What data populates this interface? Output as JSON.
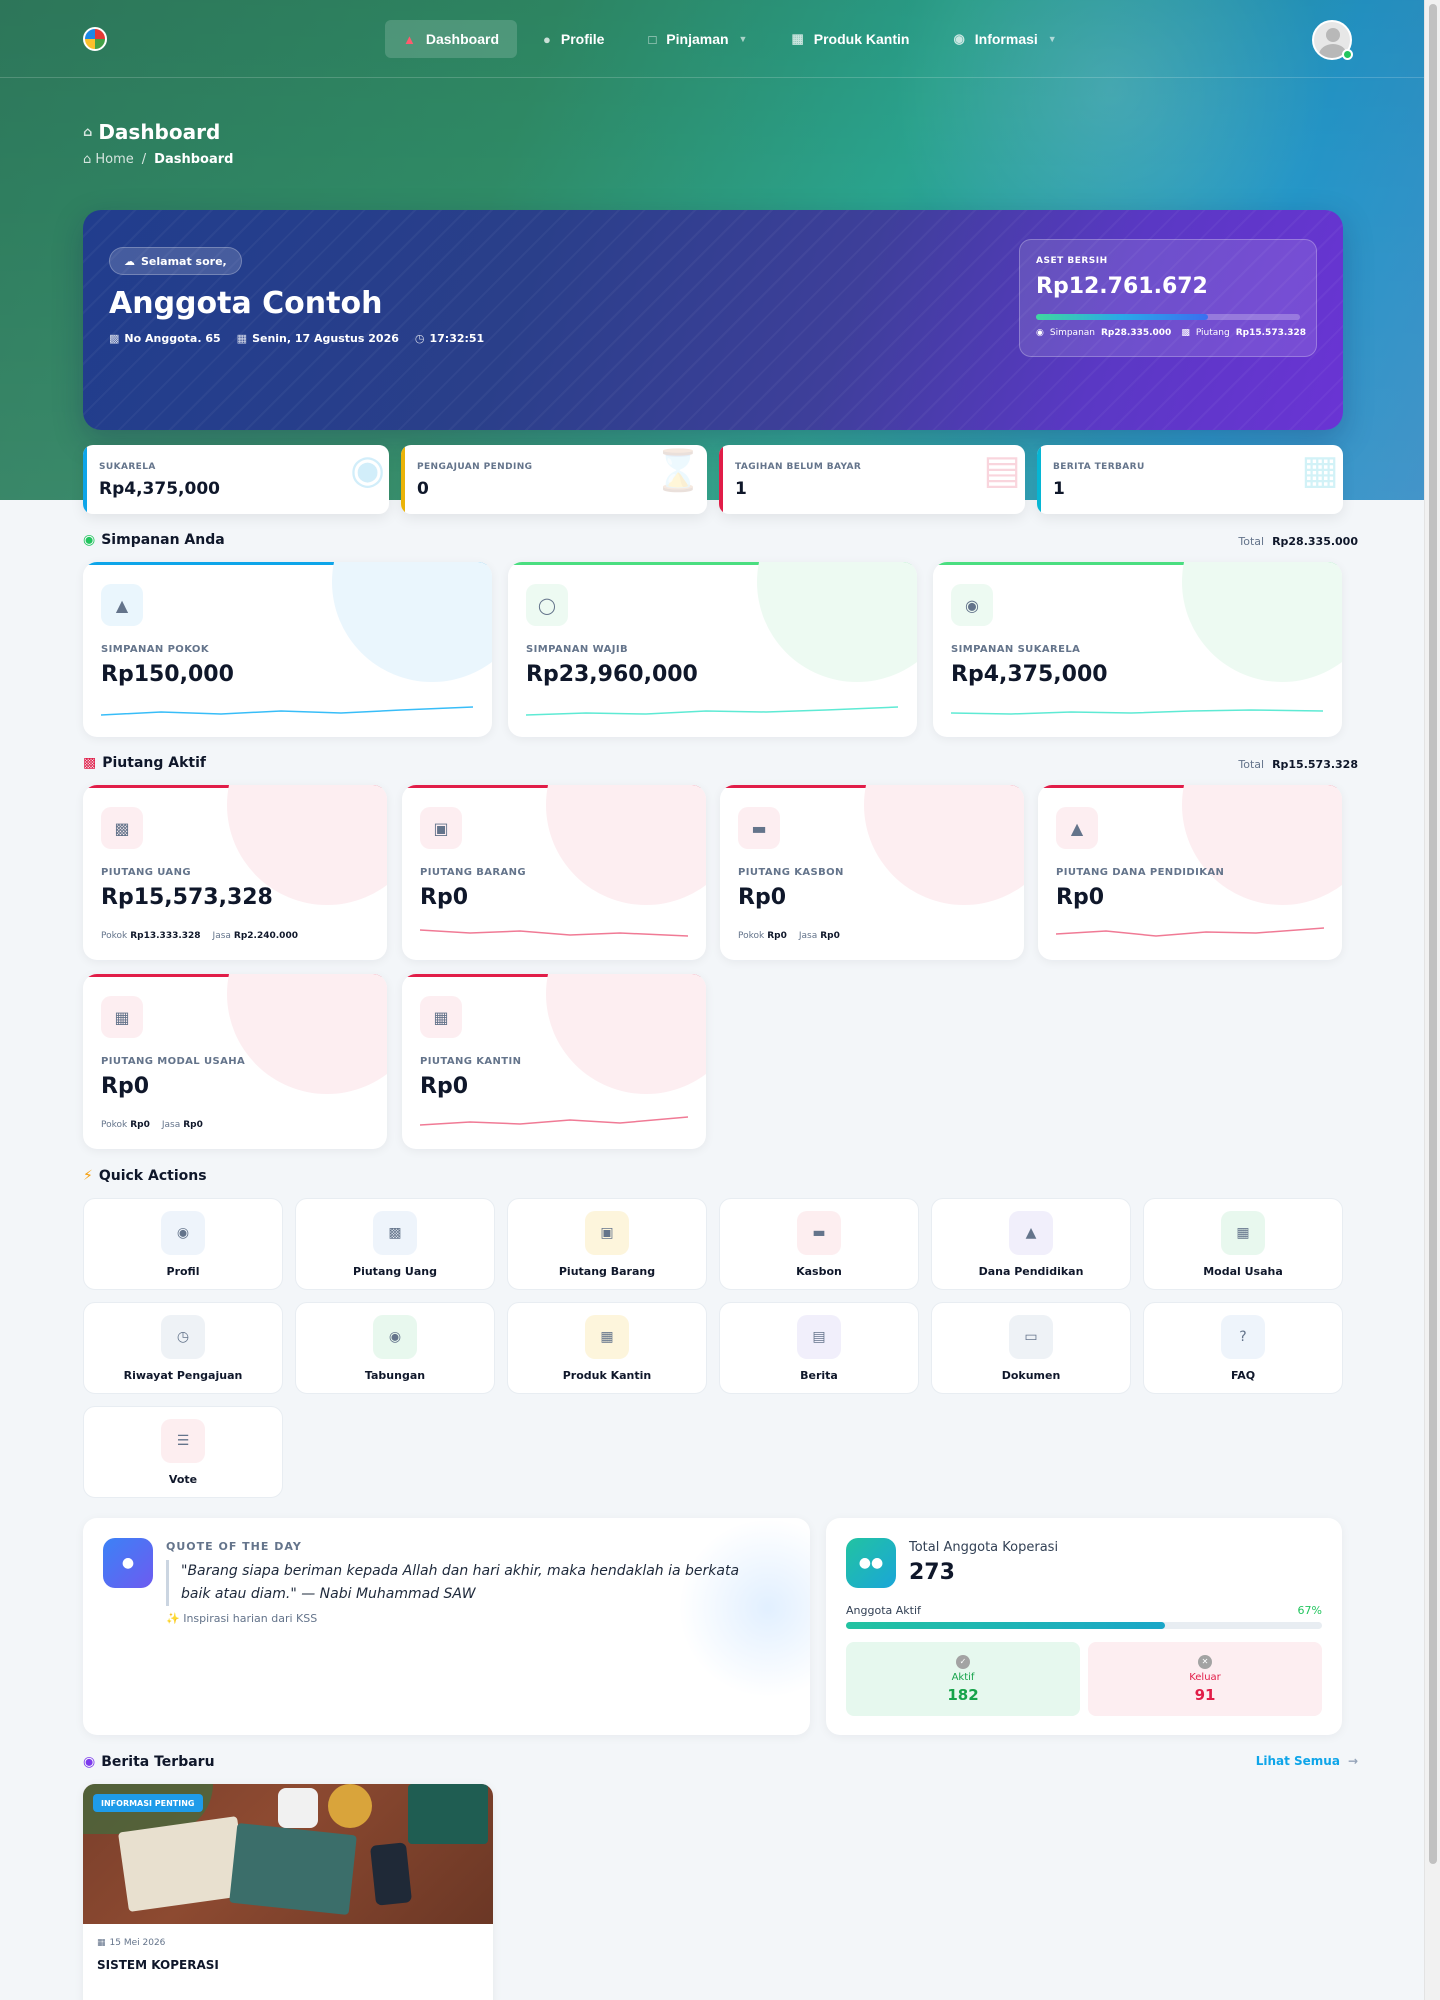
{
  "nav": {
    "items": [
      {
        "label": "Dashboard",
        "icon": "flame-icon"
      },
      {
        "label": "Profile",
        "icon": "user-icon"
      },
      {
        "label": "Pinjaman",
        "icon": "document-icon"
      },
      {
        "label": "Produk Kantin",
        "icon": "store-icon"
      },
      {
        "label": "Informasi",
        "icon": "info-icon"
      }
    ],
    "active_color": "#ff5b6e"
  },
  "header": {
    "title": "Dashboard",
    "breadcrumb": {
      "home": "Home",
      "separator": "/",
      "current": "Dashboard"
    }
  },
  "welcome": {
    "greeting": "Selamat sore,",
    "name": "Anggota Contoh",
    "member_no": "No Anggota. 65",
    "date": "Senin, 17 Agustus 2026",
    "time": "17:32:51"
  },
  "aset": {
    "label": "ASET BERSIH",
    "value": "Rp12.761.672",
    "progress": 0.65,
    "simpanan_label": "Simpanan",
    "simpanan_value": "Rp28.335.000",
    "piutang_label": "Piutang",
    "piutang_value": "Rp15.573.328"
  },
  "stats": [
    {
      "label": "SUKARELA",
      "value": "Rp4,375,000",
      "color": "#0ea5e9"
    },
    {
      "label": "PENGAJUAN PENDING",
      "value": "0",
      "color": "#eab308"
    },
    {
      "label": "TAGIHAN BELUM BAYAR",
      "value": "1",
      "color": "#e11d48"
    },
    {
      "label": "BERITA TERBARU",
      "value": "1",
      "color": "#06b6d4"
    }
  ],
  "simpanan": {
    "title": "Simpanan Anda",
    "total_label": "Total",
    "total": "Rp28.335.000",
    "cards": [
      {
        "label": "SIMPANAN POKOK",
        "value": "Rp150,000",
        "icon": "bank-icon",
        "color": "#0ea5e9"
      },
      {
        "label": "SIMPANAN WAJIB",
        "value": "Rp23,960,000",
        "icon": "shield-icon",
        "color": "#4ade80"
      },
      {
        "label": "SIMPANAN SUKARELA",
        "value": "Rp4,375,000",
        "icon": "piggy-bank-icon",
        "color": "#4ade80"
      }
    ]
  },
  "piutang": {
    "title": "Piutang Aktif",
    "total_label": "Total",
    "total": "Rp15.573.328",
    "cards": [
      {
        "label": "PIUTANG UANG",
        "value": "Rp15,573,328",
        "icon": "cash-icon",
        "pokok_label": "Pokok",
        "pokok": "Rp13.333.328",
        "jasa_label": "Jasa",
        "jasa": "Rp2.240.000"
      },
      {
        "label": "PIUTANG BARANG",
        "value": "Rp0",
        "icon": "bag-icon"
      },
      {
        "label": "PIUTANG KASBON",
        "value": "Rp0",
        "icon": "wallet-icon",
        "pokok_label": "Pokok",
        "pokok": "Rp0",
        "jasa_label": "Jasa",
        "jasa": "Rp0"
      },
      {
        "label": "PIUTANG DANA PENDIDIKAN",
        "value": "Rp0",
        "icon": "graduation-cap-icon"
      },
      {
        "label": "PIUTANG MODAL USAHA",
        "value": "Rp0",
        "icon": "shop-icon",
        "pokok_label": "Pokok",
        "pokok": "Rp0",
        "jasa_label": "Jasa",
        "jasa": "Rp0"
      },
      {
        "label": "PIUTANG KANTIN",
        "value": "Rp0",
        "icon": "store-icon"
      }
    ]
  },
  "quick_actions": {
    "title": "Quick Actions",
    "items": [
      {
        "label": "Profil",
        "icon": "user-circle-icon",
        "bg": "#eef4fb"
      },
      {
        "label": "Piutang Uang",
        "icon": "cash-icon",
        "bg": "#eef4fb"
      },
      {
        "label": "Piutang Barang",
        "icon": "bag-icon",
        "bg": "#fdf5dc"
      },
      {
        "label": "Kasbon",
        "icon": "wallet-icon",
        "bg": "#fdeef0"
      },
      {
        "label": "Dana Pendidikan",
        "icon": "graduation-cap-icon",
        "bg": "#f1effb"
      },
      {
        "label": "Modal Usaha",
        "icon": "shop-icon",
        "bg": "#e8f8ee"
      },
      {
        "label": "Riwayat Pengajuan",
        "icon": "clock-icon",
        "bg": "#eef2f6"
      },
      {
        "label": "Tabungan",
        "icon": "piggy-bank-icon",
        "bg": "#e8f8ee"
      },
      {
        "label": "Produk Kantin",
        "icon": "store-icon",
        "bg": "#fdf5dc"
      },
      {
        "label": "Berita",
        "icon": "newspaper-icon",
        "bg": "#f1effb"
      },
      {
        "label": "Dokumen",
        "icon": "folder-icon",
        "bg": "#eef2f6"
      },
      {
        "label": "FAQ",
        "icon": "question-icon",
        "bg": "#eef4fb"
      },
      {
        "label": "Vote",
        "icon": "list-check-icon",
        "bg": "#fdeef0"
      }
    ]
  },
  "quote": {
    "label": "QUOTE OF THE DAY",
    "text": "\"Barang siapa beriman kepada Allah dan hari akhir, maka hendaklah ia berkata baik atau diam.\" — Nabi Muhammad SAW",
    "source": "Inspirasi harian dari KSS"
  },
  "members": {
    "label": "Total Anggota Koperasi",
    "total": "273",
    "active_label": "Anggota Aktif",
    "active_pct": "67%",
    "active_fraction": 0.67,
    "aktif_label": "Aktif",
    "aktif": "182",
    "keluar_label": "Keluar",
    "keluar": "91"
  },
  "news": {
    "title": "Berita Terbaru",
    "see_all": "Lihat Semua",
    "items": [
      {
        "badge": "INFORMASI PENTING",
        "date": "15 Mei 2026",
        "title": "SISTEM KOPERASI"
      }
    ]
  }
}
